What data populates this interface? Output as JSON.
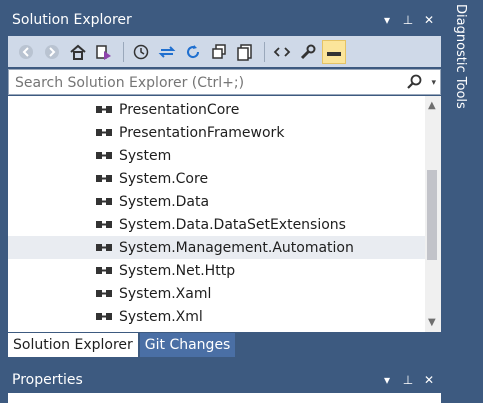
{
  "solution_explorer": {
    "title": "Solution Explorer",
    "title_buttons": [
      "▾",
      "⊥",
      "✕"
    ]
  },
  "search": {
    "placeholder": "Search Solution Explorer (Ctrl+;)"
  },
  "tree": {
    "items": [
      {
        "label": "PresentationCore"
      },
      {
        "label": "PresentationFramework"
      },
      {
        "label": "System"
      },
      {
        "label": "System.Core"
      },
      {
        "label": "System.Data"
      },
      {
        "label": "System.Data.DataSetExtensions"
      },
      {
        "label": "System.Management.Automation",
        "selected": true
      },
      {
        "label": "System.Net.Http"
      },
      {
        "label": "System.Xaml"
      },
      {
        "label": "System.Xml"
      }
    ]
  },
  "tabs": [
    "Solution Explorer",
    "Git Changes"
  ],
  "properties": {
    "title": "Properties"
  },
  "side": {
    "diagnostic_tools": "Diagnostic Tools"
  },
  "colors": {
    "frame": "#3d5a80",
    "toolbar": "#cfd9e8",
    "selected_row": "#e9ecf1",
    "active_toggle": "#fbe59b"
  }
}
